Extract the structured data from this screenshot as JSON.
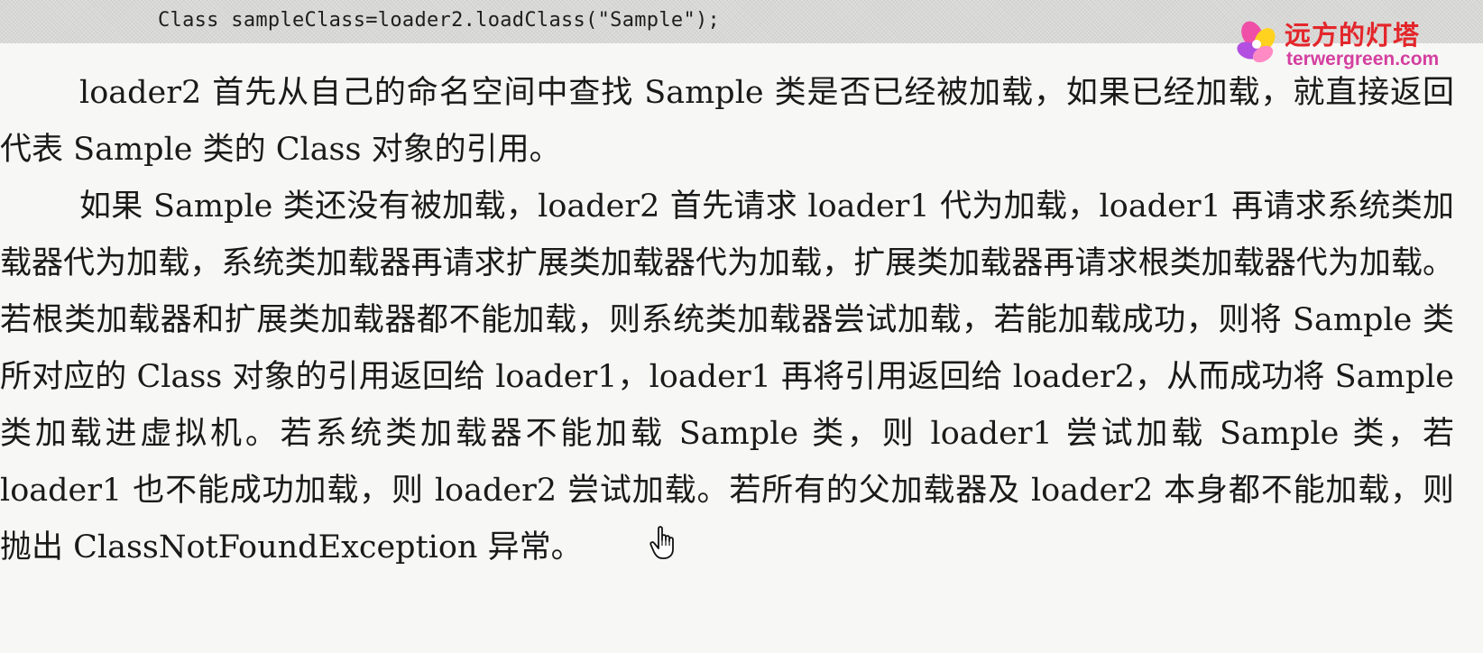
{
  "code": {
    "line": "Class sampleClass=loader2.loadClass(\"Sample\");"
  },
  "watermark": {
    "chinese": "远方的灯塔",
    "url": "terwergreen.com",
    "accent_color": "#e3262b",
    "url_color": "#d43fa0",
    "icon": "flower-icon"
  },
  "paragraphs": [
    "loader2 首先从自己的命名空间中查找 Sample 类是否已经被加载，如果已经加载，就直接返回代表 Sample 类的 Class 对象的引用。",
    "如果 Sample 类还没有被加载，loader2 首先请求 loader1 代为加载，loader1 再请求系统类加载器代为加载，系统类加载器再请求扩展类加载器代为加载，扩展类加载器再请求根类加载器代为加载。若根类加载器和扩展类加载器都不能加载，则系统类加载器尝试加载，若能加载成功，则将 Sample 类所对应的 Class 对象的引用返回给 loader1，loader1 再将引用返回给 loader2，从而成功将 Sample 类加载进虚拟机。若系统类加载器不能加载 Sample 类，则 loader1 尝试加载 Sample 类，若 loader1 也不能成功加载，则 loader2 尝试加载。若所有的父加载器及 loader2 本身都不能加载，则抛出 ClassNotFoundException 异常。"
  ],
  "cursor": {
    "icon": "hand-pointer-icon"
  }
}
